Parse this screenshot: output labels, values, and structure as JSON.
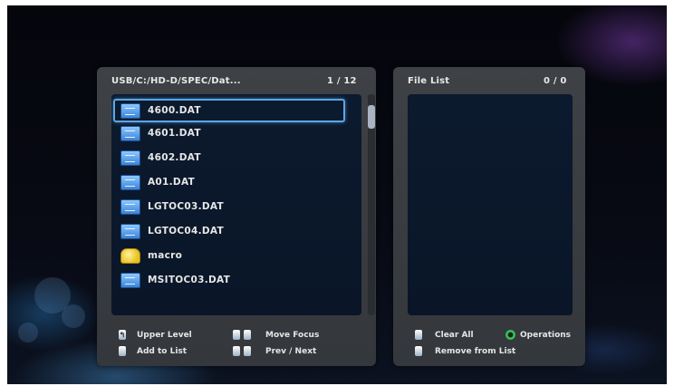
{
  "browser": {
    "path": "USB/C:/HD-D/SPEC/Dat...",
    "page": "1 / 12",
    "files": [
      {
        "name": "4600.DAT",
        "icon": "data-file-icon",
        "selected": true
      },
      {
        "name": "4601.DAT",
        "icon": "data-file-icon"
      },
      {
        "name": "4602.DAT",
        "icon": "data-file-icon"
      },
      {
        "name": "A01.DAT",
        "icon": "data-file-icon"
      },
      {
        "name": "LGTOC03.DAT",
        "icon": "data-file-icon"
      },
      {
        "name": "LGTOC04.DAT",
        "icon": "data-file-icon"
      },
      {
        "name": "macro",
        "icon": "folder-icon"
      },
      {
        "name": "MSITOC03.DAT",
        "icon": "data-file-icon"
      }
    ]
  },
  "file_list": {
    "title": "File List",
    "count": "0 / 0"
  },
  "hints": {
    "upper_level": "Upper Level",
    "add_to_list": "Add to List",
    "move_focus": "Move Focus",
    "prev_next": "Prev / Next",
    "clear_all": "Clear All",
    "operations": "Operations",
    "remove_from_list": "Remove from List"
  },
  "colors": {
    "panel": "#3a3d41",
    "list_bg": "#0b172a",
    "selection_border": "#5aa6e6",
    "operations_key": "#42c85e"
  }
}
